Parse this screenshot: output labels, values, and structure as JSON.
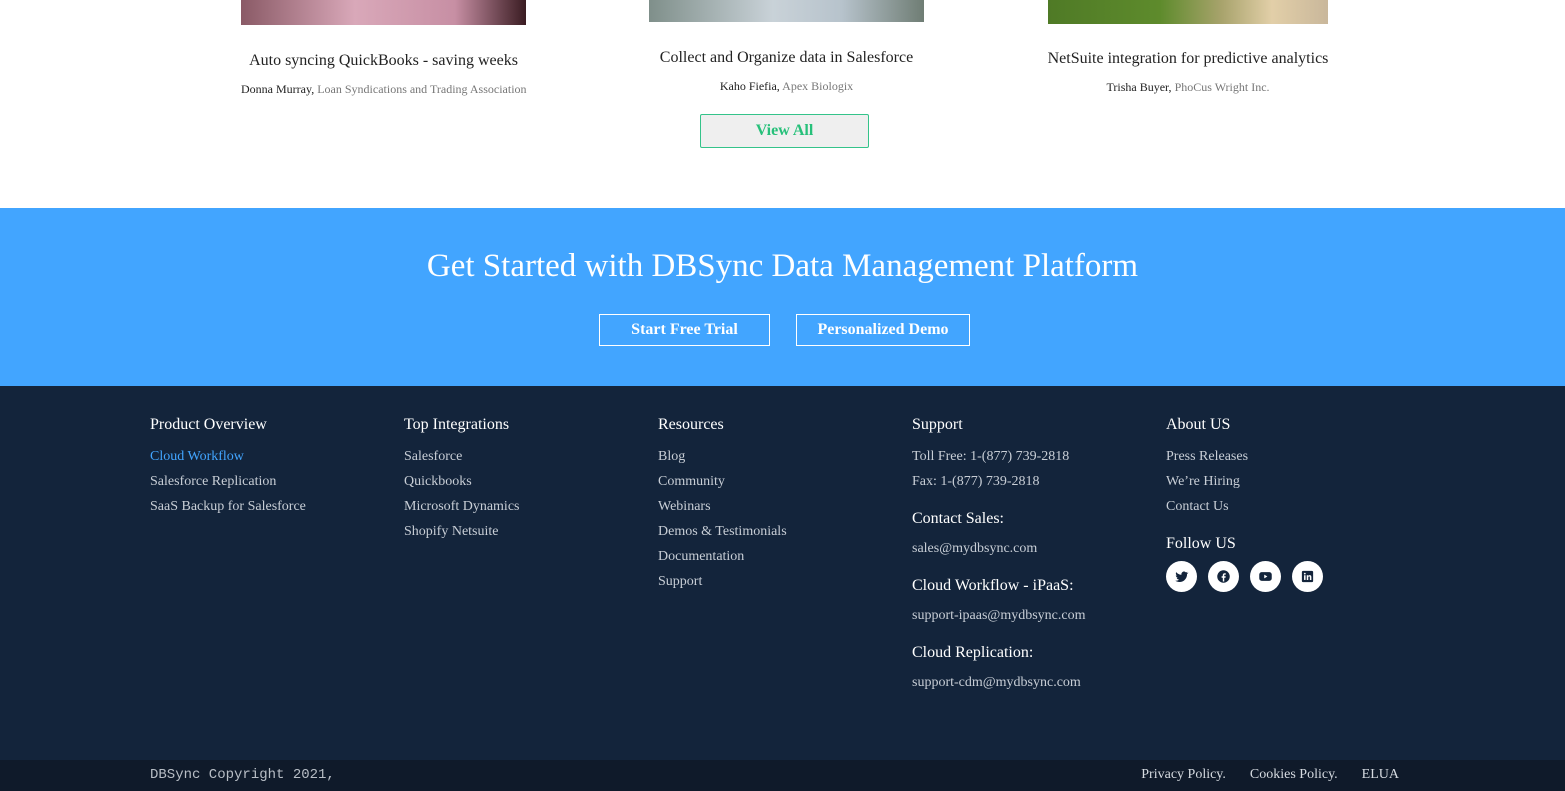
{
  "testimonials": [
    {
      "title": "Auto syncing QuickBooks - saving weeks",
      "person": "Donna Murray,",
      "org": "Loan Syndications and Trading Association",
      "thumb_color": "#b7808f"
    },
    {
      "title": "Collect and Organize data in Salesforce",
      "person": "Kaho Fiefia,",
      "org": "Apex Biologix",
      "thumb_color": "#8c9aa4"
    },
    {
      "title": "NetSuite integration for predictive analytics",
      "person": "Trisha Buyer,",
      "org": "PhoCus Wright Inc.",
      "thumb_color": "#6f8a3b"
    }
  ],
  "view_all_label": "View All",
  "cta": {
    "heading": "Get Started with DBSync Data Management Platform",
    "trial_label": "Start Free Trial",
    "demo_label": "Personalized Demo"
  },
  "footer": {
    "product": {
      "heading": "Product Overview",
      "links": [
        "Cloud Workflow",
        "Salesforce Replication",
        "SaaS Backup for Salesforce"
      ]
    },
    "integrations": {
      "heading": "Top Integrations",
      "links": [
        "Salesforce",
        "Quickbooks",
        "Microsoft Dynamics",
        "Shopify Netsuite"
      ]
    },
    "resources": {
      "heading": "Resources",
      "links": [
        "Blog",
        "Community",
        "Webinars",
        "Demos & Testimonials",
        "Documentation",
        "Support"
      ]
    },
    "support": {
      "heading": "Support",
      "toll_free": "Toll Free: 1-(877) 739-2818",
      "fax": "Fax: 1-(877) 739-2818",
      "sales_heading": "Contact Sales:",
      "sales_email": "sales@mydbsync.com",
      "ipaas_heading": "Cloud Workflow - iPaaS:",
      "ipaas_email": "support-ipaas@mydbsync.com",
      "replication_heading": "Cloud Replication:",
      "replication_email": "support-cdm@mydbsync.com"
    },
    "about": {
      "heading": "About US",
      "links": [
        "Press Releases",
        "We’re Hiring",
        "Contact Us"
      ],
      "follow_heading": "Follow US",
      "socials": [
        "twitter-icon",
        "facebook-icon",
        "youtube-icon",
        "linkedin-icon"
      ]
    }
  },
  "bottom": {
    "copyright": "DBSync Copyright 2021,",
    "privacy": "Privacy Policy.",
    "cookies": "Cookies Policy.",
    "elua": "ELUA"
  },
  "colors": {
    "accent": "#42a5ff",
    "footer_bg": "#13243b",
    "bottom_bg": "#0f1a2a",
    "view_all": "#27c07a"
  }
}
